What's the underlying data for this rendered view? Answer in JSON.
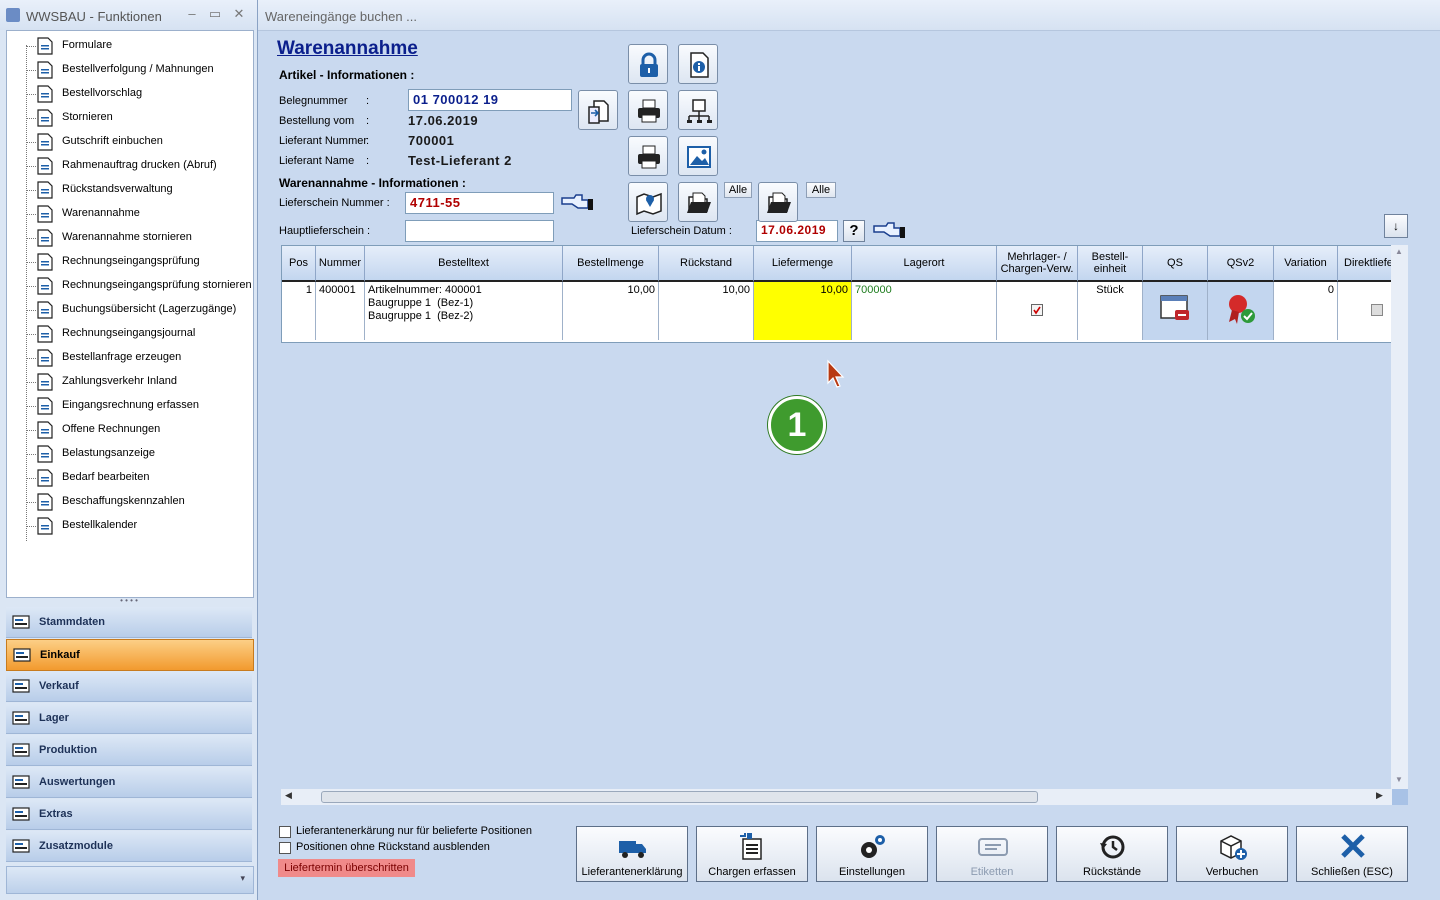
{
  "left_window": {
    "title": "WWSBAU - Funktionen",
    "controls": [
      "–",
      "▭",
      "✕"
    ],
    "tree_items": [
      {
        "label": "Formulare",
        "icon": "document-icon"
      },
      {
        "label": "Bestellverfolgung / Mahnungen",
        "icon": "map-icon"
      },
      {
        "label": "Bestellvorschlag",
        "icon": "cart-icon"
      },
      {
        "label": "Stornieren",
        "icon": "cart-cancel-icon"
      },
      {
        "label": "Gutschrift einbuchen",
        "icon": "credit-note-icon"
      },
      {
        "label": "Rahmenauftrag drucken (Abruf)",
        "icon": "print-document-icon"
      },
      {
        "label": "Rückstandsverwaltung",
        "icon": "clock-icon"
      },
      {
        "label": "Warenannahme",
        "icon": "goods-receipt-icon"
      },
      {
        "label": "Warenannahme stornieren",
        "icon": "goods-receipt-cancel-icon"
      },
      {
        "label": "Rechnungseingangsprüfung",
        "icon": "euro-invoice-icon"
      },
      {
        "label": "Rechnungseingangsprüfung stornieren",
        "icon": "euro-invoice-cancel-icon"
      },
      {
        "label": "Buchungsübersicht (Lagerzugänge)",
        "icon": "booking-overview-icon"
      },
      {
        "label": "Rechnungseingangsjournal",
        "icon": "journal-icon"
      },
      {
        "label": "Bestellanfrage erzeugen",
        "icon": "request-icon"
      },
      {
        "label": "Zahlungsverkehr Inland",
        "icon": "money-icon"
      },
      {
        "label": "Eingangsrechnung erfassen",
        "icon": "euro-entry-icon"
      },
      {
        "label": "Offene Rechnungen",
        "icon": "euro-open-icon"
      },
      {
        "label": "Belastungsanzeige",
        "icon": "weight-icon"
      },
      {
        "label": "Bedarf bearbeiten",
        "icon": "calculator-icon"
      },
      {
        "label": "Beschaffungskennzahlen",
        "icon": "table-info-icon"
      },
      {
        "label": "Bestellkalender",
        "icon": "calendar-icon"
      }
    ],
    "nav_groups": [
      {
        "label": "Stammdaten",
        "icon": "master-data-icon",
        "active": false
      },
      {
        "label": "Einkauf",
        "icon": "shopping-cart-icon",
        "active": true
      },
      {
        "label": "Verkauf",
        "icon": "cash-register-icon",
        "active": false
      },
      {
        "label": "Lager",
        "icon": "warehouse-icon",
        "active": false
      },
      {
        "label": "Produktion",
        "icon": "production-icon",
        "active": false
      },
      {
        "label": "Auswertungen",
        "icon": "analytics-icon",
        "active": false
      },
      {
        "label": "Extras",
        "icon": "extras-icon",
        "active": false
      },
      {
        "label": "Zusatzmodule",
        "icon": "modules-icon",
        "active": false
      }
    ]
  },
  "main_window": {
    "title": "Wareneingänge buchen ...",
    "heading": "Warenannahme",
    "section_article": "Artikel - Informationen :",
    "belegnummer_label": "Belegnummer",
    "belegnummer_value": "01 700012 19",
    "bestellung_vom_label": "Bestellung vom",
    "bestellung_vom_value": "17.06.2019",
    "lieferant_nummer_label": "Lieferant Nummer",
    "lieferant_nummer_value": "700001",
    "lieferant_name_label": "Lieferant Name",
    "lieferant_name_value": "Test-Lieferant 2",
    "colon": ":",
    "section_receipt": "Warenannahme - Informationen :",
    "lieferschein_nummer_label": "Lieferschein Nummer :",
    "lieferschein_nummer_value": "4711-55",
    "hauptlieferschein_label": "Hauptlieferschein :",
    "hauptlieferschein_value": "",
    "lieferschein_datum_label": "Lieferschein Datum :",
    "lieferschein_datum_value": "17.06.2019",
    "alle_label": "Alle",
    "help_label": "?",
    "sort_label": "↓"
  },
  "grid": {
    "columns": [
      "Pos",
      "Nummer",
      "Bestelltext",
      "Bestellmenge",
      "Rückstand",
      "Liefermenge",
      "Lagerort",
      "Mehrlager- / Chargen-Verw.",
      "Bestell-einheit",
      "QS",
      "QSv2",
      "Variation",
      "Direktliefe"
    ],
    "rows": [
      {
        "pos": "1",
        "nummer": "400001",
        "bestelltext_1": "Artikelnummer: 400001",
        "bestelltext_2": "Baugruppe 1  (Bez-1)",
        "bestelltext_3": "Baugruppe 1  (Bez-2)",
        "bestellmenge": "10,00",
        "rueckstand": "10,00",
        "liefermenge": "10,00",
        "lagerort": "700000",
        "einheit": "Stück",
        "variation": "0"
      }
    ]
  },
  "annotation_marker": "1",
  "checkboxes": [
    {
      "label": "Lieferantenerkärung nur für belieferte Positionen",
      "checked": false
    },
    {
      "label": "Positionen ohne Rückstand ausblenden",
      "checked": false
    }
  ],
  "overdue_badge": "Liefertermin überschritten",
  "bottom_buttons": [
    {
      "label": "Lieferantenerklärung",
      "icon": "truck-icon",
      "enabled": true
    },
    {
      "label": "Chargen erfassen",
      "icon": "batch-icon",
      "enabled": true
    },
    {
      "label": "Einstellungen",
      "icon": "gears-icon",
      "enabled": true
    },
    {
      "label": "Etiketten",
      "icon": "label-icon",
      "enabled": false
    },
    {
      "label": "Rückstände",
      "icon": "history-icon",
      "enabled": true
    },
    {
      "label": "Verbuchen",
      "icon": "box-add-icon",
      "enabled": true
    },
    {
      "label": "Schließen (ESC)",
      "icon": "close-x-icon",
      "enabled": true
    }
  ],
  "colors": {
    "accent_blue": "#0b1f8c",
    "red_value": "#b00000",
    "highlight_yellow": "#ffff00",
    "active_nav": "#f29a2e",
    "marker_green": "#3f9b2e",
    "badge_red": "#f08a8a"
  }
}
